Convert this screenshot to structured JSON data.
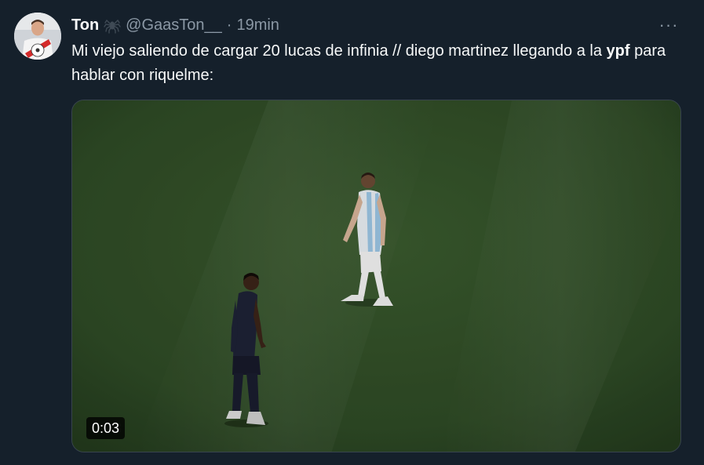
{
  "author": {
    "display_name": "Ton",
    "handle": "@GaasTon__",
    "separator": "·",
    "timestamp": "19min",
    "emoji_icon": "spider-icon"
  },
  "more_menu": {
    "label": "···",
    "icon": "more-horizontal-icon"
  },
  "tweet": {
    "text_before": "Mi viejo saliendo de cargar 20 lucas de infinia // diego martinez llegando a la ",
    "text_bold": "ypf",
    "text_after": " para hablar con riquelme:"
  },
  "media": {
    "type": "video",
    "duration": "0:03"
  },
  "colors": {
    "background": "#15202b",
    "text_primary": "#f7f9f9",
    "text_secondary": "#8b98a5",
    "pitch": "#2d4a24"
  }
}
